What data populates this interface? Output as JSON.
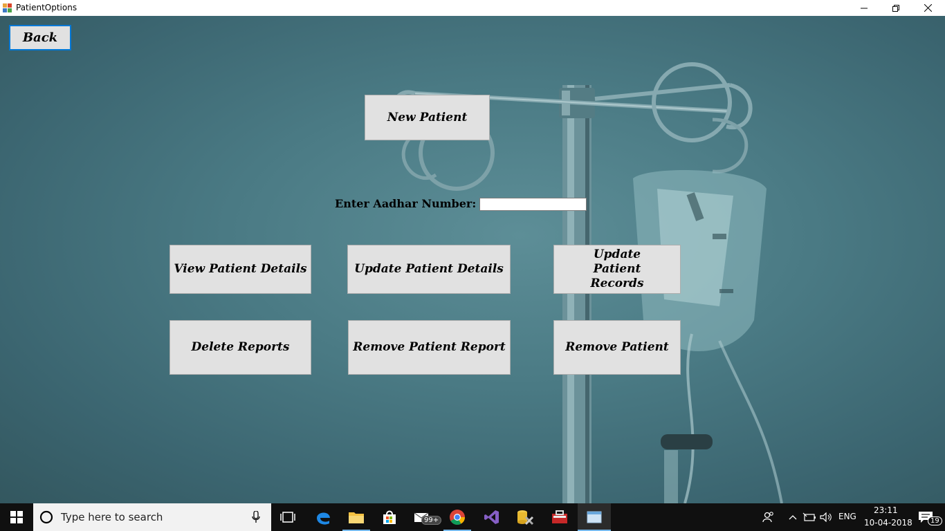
{
  "window": {
    "title": "PatientOptions"
  },
  "form": {
    "back_label": "Back",
    "new_patient_label": "New Patient",
    "aadhar_label": "Enter Aadhar Number:",
    "aadhar_value": "",
    "view_details_label": "View Patient Details",
    "update_details_label": "Update Patient Details",
    "update_records_label": "Update Patient Records",
    "delete_reports_label": "Delete Reports",
    "remove_report_label": "Remove Patient Report",
    "remove_patient_label": "Remove Patient"
  },
  "taskbar": {
    "search_placeholder": "Type here to search",
    "mail_badge": "99+",
    "language": "ENG",
    "time": "23:11",
    "date": "10-04-2018",
    "notification_count": "19"
  },
  "colors": {
    "background": "#4a7a84",
    "button_face": "#e1e1e1",
    "focus_border": "#0078d7",
    "taskbar": "#101010"
  }
}
